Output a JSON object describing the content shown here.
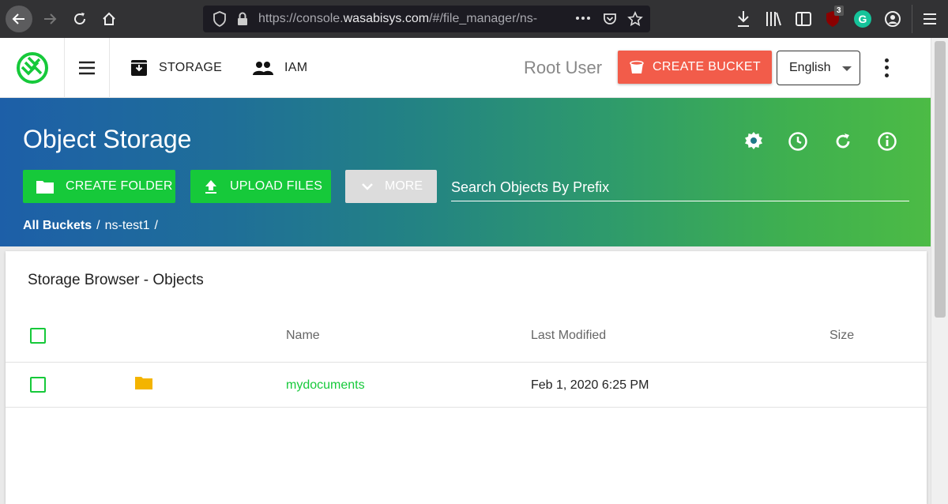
{
  "browser": {
    "url_prefix": "https://console.",
    "url_domain": "wasabisys.com",
    "url_suffix": "/#/file_manager/ns-",
    "ublock_badge": "3"
  },
  "header": {
    "nav_storage": "STORAGE",
    "nav_iam": "IAM",
    "user": "Root User",
    "create_bucket": "CREATE BUCKET",
    "language": "English"
  },
  "banner": {
    "title": "Object Storage",
    "create_folder": "CREATE FOLDER",
    "upload_files": "UPLOAD FILES",
    "more": "MORE",
    "search_placeholder": "Search Objects By Prefix",
    "breadcrumb_root": "All Buckets",
    "breadcrumb_sep": "/",
    "breadcrumb_bucket": "ns-test1"
  },
  "browser_card": {
    "title": "Storage Browser - Objects",
    "columns": {
      "name": "Name",
      "modified": "Last Modified",
      "size": "Size"
    },
    "rows": [
      {
        "name": "mydocuments",
        "modified": "Feb 1, 2020 6:25 PM",
        "size": ""
      }
    ]
  },
  "colors": {
    "accent_green": "#16c93a",
    "create_bucket": "#f25c4a",
    "folder": "#f4b400"
  }
}
